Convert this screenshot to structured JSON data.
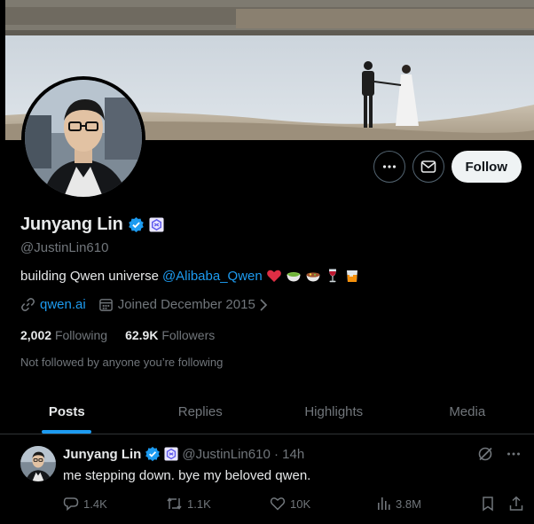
{
  "colors": {
    "accent": "#1d9bf0",
    "muted": "#71767b",
    "text": "#e7e9ea",
    "heart": "#f91880"
  },
  "profile": {
    "name": "Junyang Lin",
    "handle": "@JustinLin610",
    "bio_prefix": "building Qwen universe",
    "bio_mention": "@Alibaba_Qwen",
    "bio_emojis": [
      "red-heart",
      "matcha-bowl",
      "hotpot-bowl",
      "wine-glass",
      "tumbler-glass"
    ],
    "website": "qwen.ai",
    "joined": "Joined December 2015",
    "following_count": "2,002",
    "following_label": "Following",
    "followers_count": "62.9K",
    "followers_label": "Followers",
    "not_followed": "Not followed by anyone you’re following",
    "verified_icon": "verified-badge-icon",
    "affiliate_icon": "qwen-affiliate-icon"
  },
  "actions": {
    "more_icon": "ellipsis-icon",
    "message_icon": "envelope-icon",
    "follow_label": "Follow"
  },
  "tabs": [
    {
      "label": "Posts",
      "active": true
    },
    {
      "label": "Replies",
      "active": false
    },
    {
      "label": "Highlights",
      "active": false
    },
    {
      "label": "Media",
      "active": false
    }
  ],
  "post": {
    "name": "Junyang Lin",
    "handle_time": "@JustinLin610 · 14h",
    "text": "me stepping down. bye my beloved qwen.",
    "replies": "1.4K",
    "reposts": "1.1K",
    "likes": "10K",
    "views": "3.8M"
  }
}
